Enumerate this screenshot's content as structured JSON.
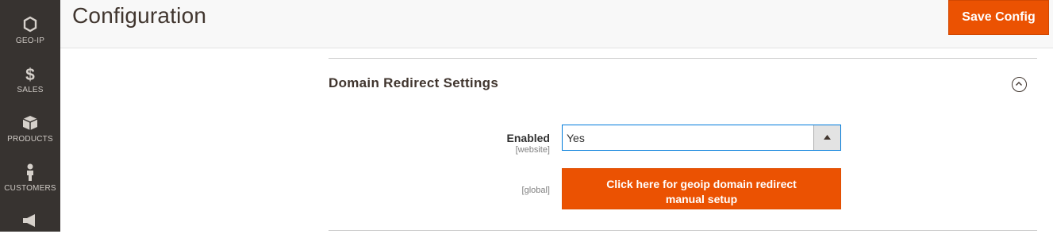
{
  "sidebar": {
    "items": [
      {
        "label": "GEO-IP",
        "icon": "hexagon-icon"
      },
      {
        "label": "SALES",
        "icon": "dollar-icon"
      },
      {
        "label": "PRODUCTS",
        "icon": "box-icon"
      },
      {
        "label": "CUSTOMERS",
        "icon": "person-icon"
      },
      {
        "label": "",
        "icon": "megaphone-icon"
      }
    ]
  },
  "header": {
    "title": "Configuration",
    "save_label": "Save Config"
  },
  "section": {
    "title": "Domain Redirect Settings",
    "enabled_label": "Enabled",
    "enabled_scope": "[website]",
    "enabled_value": "Yes",
    "manual_scope": "[global]",
    "manual_button_label": "Click here for geoip domain redirect manual setup"
  },
  "colors": {
    "accent": "#eb5202",
    "sidebar": "#373330",
    "focus": "#007bdb"
  }
}
